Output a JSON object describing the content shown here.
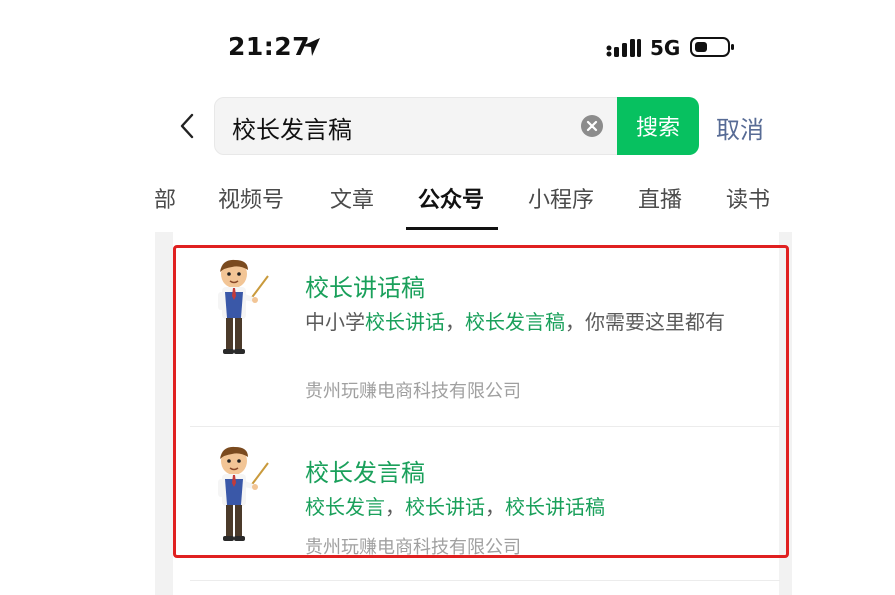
{
  "status_bar": {
    "time": "21:27",
    "network": "5G"
  },
  "search": {
    "query": "校长发言稿",
    "button_label": "搜索",
    "cancel_label": "取消"
  },
  "tabs": [
    {
      "label": "部"
    },
    {
      "label": "视频号"
    },
    {
      "label": "文章"
    },
    {
      "label": "公众号",
      "active": true
    },
    {
      "label": "小程序"
    },
    {
      "label": "直播"
    },
    {
      "label": "读书"
    }
  ],
  "results": [
    {
      "title": "校长讲话稿",
      "desc_parts": [
        "中小学",
        "校长讲话",
        "，",
        "校长发言稿",
        "，你需要这里都有"
      ],
      "company": "贵州玩赚电商科技有限公司"
    },
    {
      "title": "校长发言稿",
      "desc_parts": [
        "校长发言",
        "，",
        "校长讲话",
        "，",
        "校长讲话稿"
      ],
      "company": "贵州玩赚电商科技有限公司"
    }
  ],
  "colors": {
    "accent": "#07c160",
    "highlight_text": "#1aa05b",
    "link": "#576b95",
    "annotation": "#e02020"
  },
  "icons": [
    "location-arrow-icon",
    "signal-icon",
    "battery-icon",
    "back-chevron-icon",
    "clear-icon",
    "teacher-avatar-icon"
  ]
}
